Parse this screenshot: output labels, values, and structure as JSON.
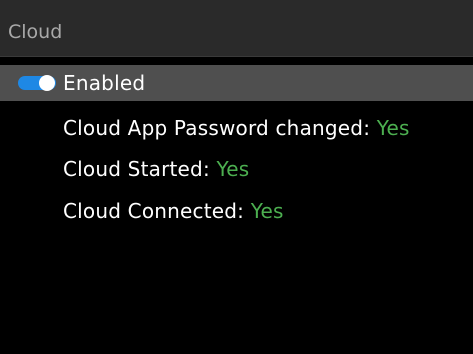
{
  "header": {
    "title": "Cloud"
  },
  "enabled_item": {
    "label": "Enabled",
    "toggle_state": "on"
  },
  "status_items": [
    {
      "label": "Cloud App Password changed: ",
      "value": "Yes"
    },
    {
      "label": "Cloud Started: ",
      "value": "Yes"
    },
    {
      "label": "Cloud Connected: ",
      "value": "Yes"
    }
  ],
  "colors": {
    "background": "#000000",
    "title_bar": "#2a2a2a",
    "selected_row": "#4f4f4f",
    "toggle_on": "#1e88e5",
    "value_green": "#4caf50"
  }
}
